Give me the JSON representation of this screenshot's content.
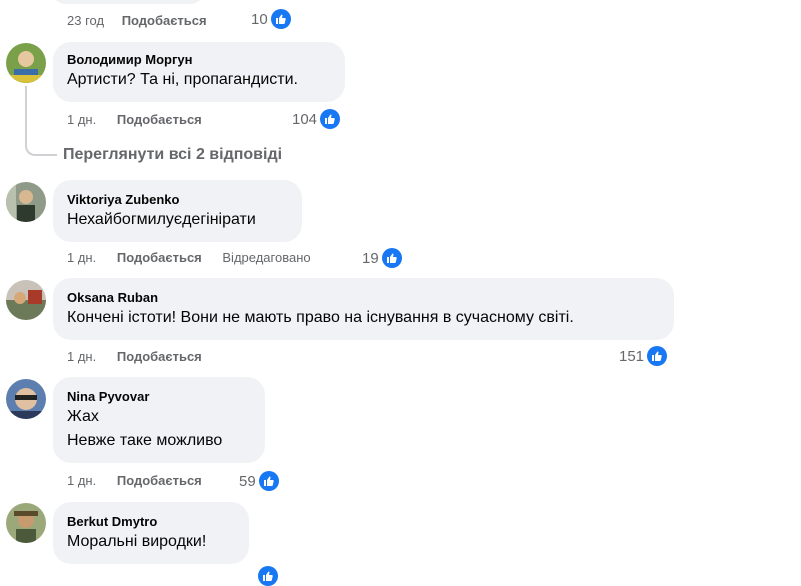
{
  "colors": {
    "bubble": "#f0f2f5",
    "meta": "#65676b",
    "like_blue": "#1877f2"
  },
  "top_comment": {
    "time": "23 год",
    "like_label": "Подобається",
    "reactions": "10"
  },
  "comments": [
    {
      "author": "Володимир Моргун",
      "lines": [
        "Артисти? Та ні, пропагандисти."
      ],
      "time": "1 дн.",
      "like_label": "Подобається",
      "reactions": "104"
    },
    {
      "author": "Viktoriya Zubenko",
      "lines": [
        "Нехайбогмилуєдегінірати"
      ],
      "time": "1 дн.",
      "like_label": "Подобається",
      "edited": "Відредаговано",
      "reactions": "19"
    },
    {
      "author": "Oksana Ruban",
      "lines": [
        "Кончені істоти! Вони не мають право на існування в сучасному світі."
      ],
      "time": "1 дн.",
      "like_label": "Подобається",
      "reactions": "151"
    },
    {
      "author": "Nina Pyvovar",
      "lines": [
        "Жах",
        "Невже таке можливо"
      ],
      "time": "1 дн.",
      "like_label": "Подобається",
      "reactions": "59"
    },
    {
      "author": "Berkut Dmytro",
      "lines": [
        "Моральні виродки!"
      ]
    }
  ],
  "view_replies": "Переглянути всі 2 відповіді",
  "icons": {
    "like": "thumbs-up-icon"
  }
}
